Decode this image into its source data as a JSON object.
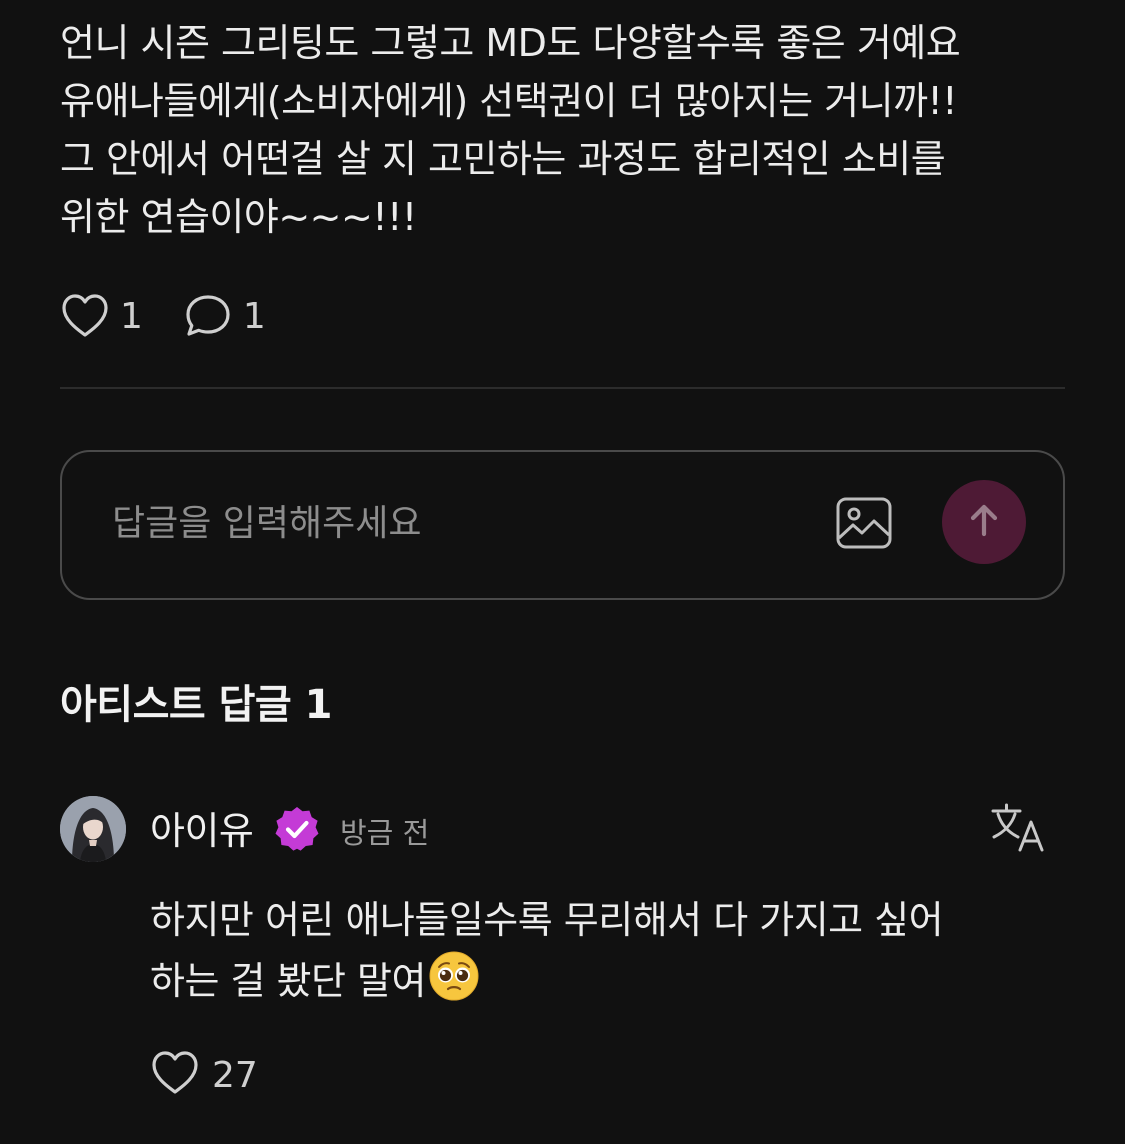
{
  "post": {
    "lines": [
      "언니 시즌 그리팅도 그렇고 MD도 다양할수록 좋은 거예요",
      "유애나들에게(소비자에게) 선택권이 더 많아지는 거니까!!",
      "그 안에서 어떤걸 살 지 고민하는 과정도 합리적인 소비를",
      "위한 연습이야~~~!!!"
    ],
    "like_count": "1",
    "comment_count": "1",
    "like_icon": "heart-outline-icon",
    "comment_icon": "speech-bubble-icon"
  },
  "reply_input": {
    "placeholder": "답글을 입력해주세요",
    "value": "",
    "image_icon": "image-icon",
    "send_icon": "arrow-up-icon",
    "send_color": "#4e1a35"
  },
  "artist_replies": {
    "title": "아티스트 답글 1",
    "items": [
      {
        "author": "아이유",
        "badge_icon": "verified-badge-icon",
        "badge_color": "#c43bd6",
        "time": "방금 전",
        "translate_icon": "translate-icon",
        "lines": [
          "하지만 어린 애나들일수록 무리해서 다 가지고 싶어",
          "하는 걸 봤단 말여"
        ],
        "emoji": "pleading-face-emoji",
        "like_count": "27",
        "like_icon": "heart-outline-icon"
      }
    ]
  }
}
